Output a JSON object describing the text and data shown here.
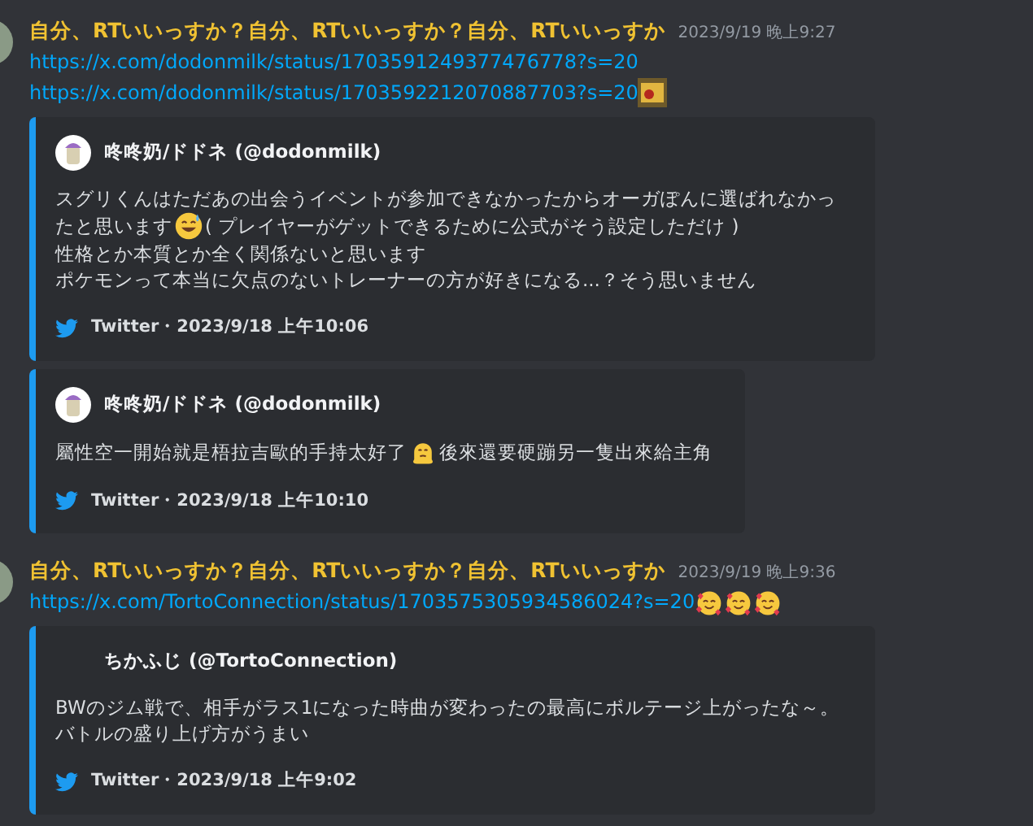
{
  "messages": [
    {
      "author": "自分、RTいいっすか？自分、RTいいっすか？自分、RTいいっすか",
      "timestamp": "2023/9/19 晚上9:27",
      "links": [
        {
          "url": "https://x.com/dodonmilk/status/1703591249377476778?s=20",
          "thumbnail": false
        },
        {
          "url": "https://x.com/dodonmilk/status/1703592212070887703?s=20",
          "thumbnail": true
        }
      ],
      "embeds": [
        {
          "author": "咚咚奶/ドドネ (@dodonmilk)",
          "avatar": true,
          "wide": true,
          "lines": [
            [
              {
                "kind": "text",
                "text": "スグリくんはただあの出会うイベントが参加できなかったからオーガぽんに選ばれなかっ"
              }
            ],
            [
              {
                "kind": "text",
                "text": "たと思います"
              },
              {
                "kind": "sweat-emoji"
              },
              {
                "kind": "text",
                "text": "( プレイヤーがゲットできるために公式がそう設定しただけ )"
              }
            ],
            [
              {
                "kind": "text",
                "text": "性格とか本質とか全く関係ないと思います"
              }
            ],
            [
              {
                "kind": "text",
                "text": "ポケモンって本当に欠点のないトレーナーの方が好きになる...？そう思いません"
              }
            ]
          ],
          "footer": "Twitter・2023/9/18 上午10:06"
        },
        {
          "author": "咚咚奶/ドドネ (@dodonmilk)",
          "avatar": true,
          "wide": false,
          "lines": [
            [
              {
                "kind": "text",
                "text": "屬性空一開始就是梧拉吉歐的手持太好了"
              },
              {
                "kind": "melting-emoji"
              },
              {
                "kind": "text",
                "text": "後來還要硬蹦另一隻出來給主角"
              }
            ]
          ],
          "footer": "Twitter・2023/9/18 上午10:10"
        }
      ]
    },
    {
      "author": "自分、RTいいっすか？自分、RTいいっすか？自分、RTいいっすか",
      "timestamp": "2023/9/19 晚上9:36",
      "links": [
        {
          "url": "https://x.com/TortoConnection/status/1703575305934586024?s=20",
          "thumbnail": false
        }
      ],
      "trailing_emojis": [
        {
          "kind": "hearts-emoji"
        },
        {
          "kind": "hearts-emoji"
        },
        {
          "kind": "hearts-emoji"
        }
      ],
      "embeds": [
        {
          "author": "ちかふじ (@TortoConnection)",
          "avatar": false,
          "wide": true,
          "lines": [
            [
              {
                "kind": "text",
                "text": "BWのジム戦で、相手がラス1になった時曲が変わったの最高にボルテージ上がったな～。"
              }
            ],
            [
              {
                "kind": "text",
                "text": "バトルの盛り上げ方がうまい"
              }
            ]
          ],
          "footer": "Twitter・2023/9/18 上午9:02"
        }
      ]
    }
  ]
}
